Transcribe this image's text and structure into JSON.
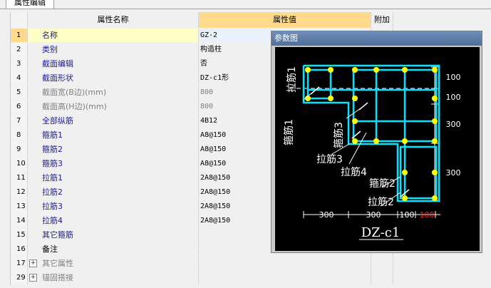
{
  "tab": {
    "label": "属性编辑"
  },
  "header": {
    "num": "",
    "name": "属性名称",
    "value": "属性值",
    "extra": "附加"
  },
  "rows": [
    {
      "num": "1",
      "name": "名称",
      "value": "GZ-2"
    },
    {
      "num": "2",
      "name": "类别",
      "value": "构造柱"
    },
    {
      "num": "3",
      "name": "截面编辑",
      "value": "否"
    },
    {
      "num": "4",
      "name": "截面形状",
      "value": "DZ-c1形"
    },
    {
      "num": "5",
      "name": "截面宽(B边)(mm)",
      "value": "800"
    },
    {
      "num": "6",
      "name": "截面高(H边)(mm)",
      "value": "800"
    },
    {
      "num": "7",
      "name": "全部纵筋",
      "value": "4B12"
    },
    {
      "num": "8",
      "name": "箍筋1",
      "value": "A8@150"
    },
    {
      "num": "9",
      "name": "箍筋2",
      "value": "A8@150"
    },
    {
      "num": "10",
      "name": "箍筋3",
      "value": "A8@150"
    },
    {
      "num": "11",
      "name": "拉筋1",
      "value": "2A8@150"
    },
    {
      "num": "12",
      "name": "拉筋2",
      "value": "2A8@150"
    },
    {
      "num": "13",
      "name": "拉筋3",
      "value": "2A8@150"
    },
    {
      "num": "14",
      "name": "拉筋4",
      "value": "2A8@150"
    },
    {
      "num": "15",
      "name": "其它箍筋",
      "value": ""
    },
    {
      "num": "16",
      "name": "备注",
      "value": ""
    },
    {
      "num": "17",
      "name": "其它属性",
      "value": "",
      "expand": "+"
    },
    {
      "num": "29",
      "name": "锚固搭接",
      "value": "",
      "expand": "+"
    }
  ],
  "reference": {
    "title": "参数图",
    "shape_label": "DZ-c1",
    "labels": {
      "lajin1": "拉筋1",
      "gujin1": "箍筋1",
      "gujin3": "箍筋3",
      "lajin3": "拉筋3",
      "lajin4": "拉筋4",
      "gujin2": "箍筋2",
      "lajin2": "拉筋2"
    },
    "dims_right": [
      "100",
      "100",
      "300",
      "300"
    ],
    "dims_bottom": [
      "300",
      "300",
      "100",
      "100"
    ],
    "colors": {
      "stirrup": "#00e5ff",
      "bar": "#ffff00",
      "hook": "#ff40ff",
      "dim": "#ffffff",
      "highlight": "#ff2020"
    }
  }
}
